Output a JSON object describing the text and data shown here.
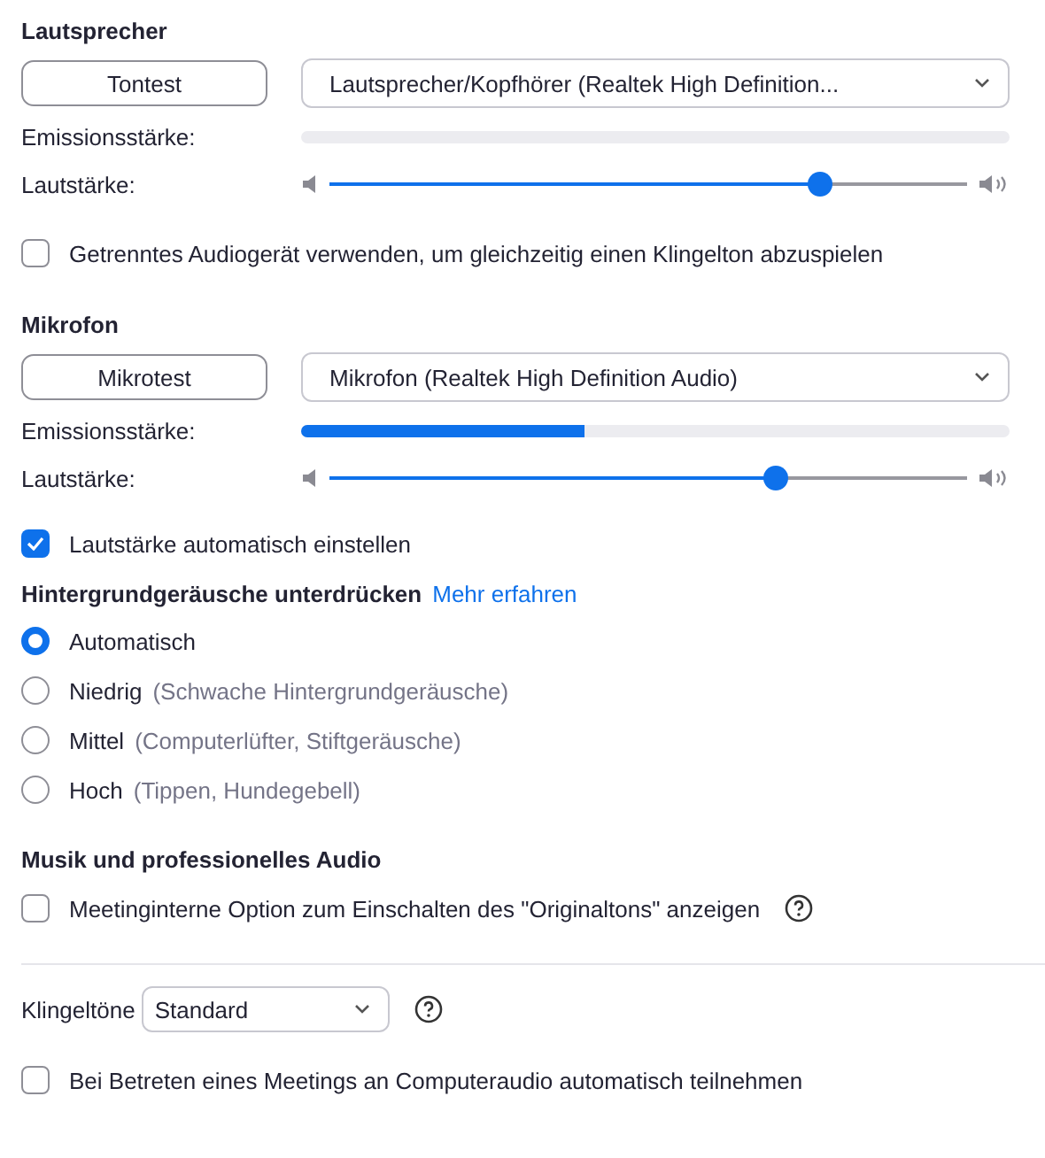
{
  "speaker": {
    "heading": "Lautsprecher",
    "test_button": "Tontest",
    "device": "Lautsprecher/Kopfhörer (Realtek High Definition...",
    "emission": {
      "label": "Emissionsstärke:"
    },
    "volume": {
      "label": "Lautstärke:",
      "level": 0.77
    }
  },
  "separate_device": {
    "label": "Getrenntes Audiogerät verwenden, um gleichzeitig einen Klingelton abzuspielen",
    "checked": false
  },
  "microphone": {
    "heading": "Mikrofon",
    "test_button": "Mikrotest",
    "device": "Mikrofon (Realtek High Definition Audio)",
    "emission": {
      "label": "Emissionsstärke:",
      "level": 0.4
    },
    "volume": {
      "label": "Lautstärke:",
      "level": 0.7
    }
  },
  "auto_volume": {
    "label": "Lautstärke automatisch einstellen",
    "checked": true
  },
  "noise": {
    "heading": "Hintergrundgeräusche unterdrücken",
    "link": "Mehr erfahren",
    "options": [
      {
        "label": "Automatisch",
        "selected": true
      },
      {
        "label": "Niedrig",
        "hint": "(Schwache Hintergrundgeräusche)",
        "selected": false
      },
      {
        "label": "Mittel",
        "hint": "(Computerlüfter, Stiftgeräusche)",
        "selected": false
      },
      {
        "label": "Hoch",
        "hint": "(Tippen, Hundegebell)",
        "selected": false
      }
    ]
  },
  "music": {
    "heading": "Musik und professionelles Audio",
    "original_sound": {
      "label": "Meetinginterne Option zum Einschalten des \"Originaltons\" anzeigen",
      "checked": false
    }
  },
  "ringtone": {
    "label": "Klingeltöne",
    "value": "Standard"
  },
  "auto_join": {
    "label": "Bei Betreten eines Meetings an Computeraudio automatisch teilnehmen",
    "checked": false
  }
}
